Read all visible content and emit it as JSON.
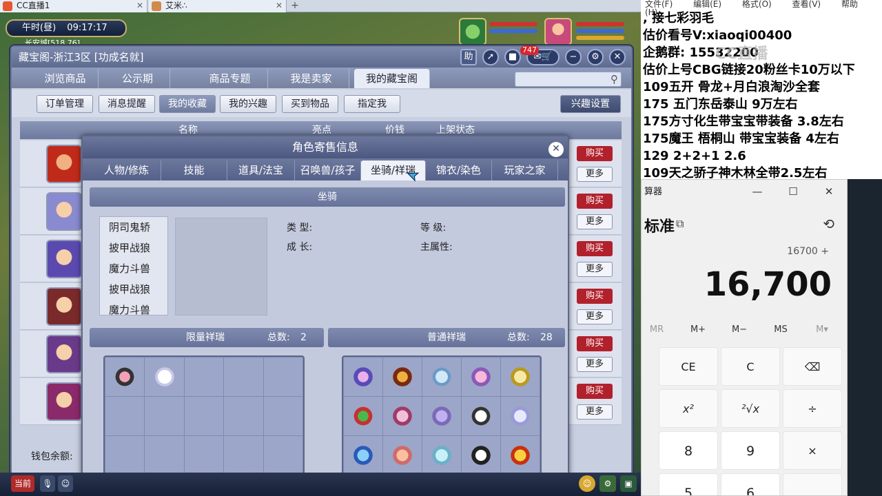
{
  "browser": {
    "tabs": [
      {
        "label": "CC直播1"
      },
      {
        "label": "艾米∴"
      }
    ],
    "add_tab": "+"
  },
  "game": {
    "clock": {
      "period": "午时(昼)",
      "time": "09:17:17"
    },
    "location": "长安城[518,76]",
    "window": {
      "title": "藏宝阁-浙江3区 [功成名就]",
      "help_label": "助",
      "message_count": "747",
      "nav_tabs": [
        "浏览商品",
        "公示期",
        "商品专题",
        "我是卖家",
        "我的藏宝阁"
      ],
      "active_nav": 4,
      "sub_buttons": [
        "订单管理",
        "消息提醒",
        "我的收藏",
        "我的兴趣",
        "买到物品",
        "指定我"
      ],
      "active_sub": 2,
      "interest_settings": "兴趣设置",
      "table_headers": [
        "名称",
        "亮点",
        "价钱",
        "上架状态"
      ],
      "rows": [
        {
          "buy": "购买",
          "more": "更多"
        },
        {
          "buy": "购买",
          "more": "更多"
        },
        {
          "buy": "购买",
          "more": "更多"
        },
        {
          "buy": "购买",
          "more": "更多"
        },
        {
          "buy": "购买",
          "more": "更多"
        },
        {
          "buy": "购买",
          "more": "更多"
        }
      ],
      "wallet_label": "钱包余额:"
    },
    "dialog": {
      "title": "角色寄售信息",
      "tabs": [
        "人物/修炼",
        "技能",
        "道具/法宝",
        "召唤兽/孩子",
        "坐骑/祥瑞",
        "锦衣/染色",
        "玩家之家",
        "更多"
      ],
      "active_tab": 4,
      "mount_section": "坐骑",
      "mounts": [
        "阴司鬼轿",
        "披甲战狼",
        "魔力斗兽",
        "披甲战狼",
        "魔力斗兽"
      ],
      "fields": {
        "type_label": "类    型:",
        "level_label": "等    级:",
        "growth_label": "成    长:",
        "main_attr_label": "主属性:"
      },
      "limited_title": "限量祥瑞",
      "limited_total_label": "总数:",
      "limited_total": "2",
      "normal_title": "普通祥瑞",
      "normal_total_label": "总数:",
      "normal_total": "28"
    },
    "hud": {
      "current_label": "当前"
    }
  },
  "notepad": {
    "menu": [
      "文件(F)",
      "编辑(E)",
      "格式(O)",
      "查看(V)",
      "帮助(H)"
    ],
    "lines": [
      ",       接七彩羽毛",
      "估价看号V:xiaoqi00400",
      "企鹅群: 15532200",
      "估价上号CBG链接20粉丝卡10万以下",
      "109五开 骨龙+月白浪淘沙全套",
      "175 五门东岳泰山  9万左右",
      "175方寸化生带宝宝带装备  3.8左右",
      "175魔王 梧桐山  带宝宝装备 4左右",
      "129 2+2+1  2.6",
      "109天之骄子神木林全带2.5左右"
    ],
    "watermark": "CC直播"
  },
  "calculator": {
    "title": "算器",
    "controls": [
      "—",
      "☐",
      "✕"
    ],
    "mode": "标准",
    "expression": "16700 +",
    "display": "16,700",
    "memory": [
      "MR",
      "M+",
      "M−",
      "MS",
      "M▾"
    ],
    "keys_row1": [
      "CE",
      "C",
      "⌫"
    ],
    "keys_row2": [
      "x²",
      "²√x",
      "÷"
    ],
    "keys_row3": [
      "8",
      "9",
      "×"
    ],
    "keys_row4": [
      "5",
      "6",
      ""
    ]
  },
  "colors": {
    "buy_button": "#b1212c",
    "window_bg": "#c7cfe0",
    "nav_bg": "#76829f"
  }
}
